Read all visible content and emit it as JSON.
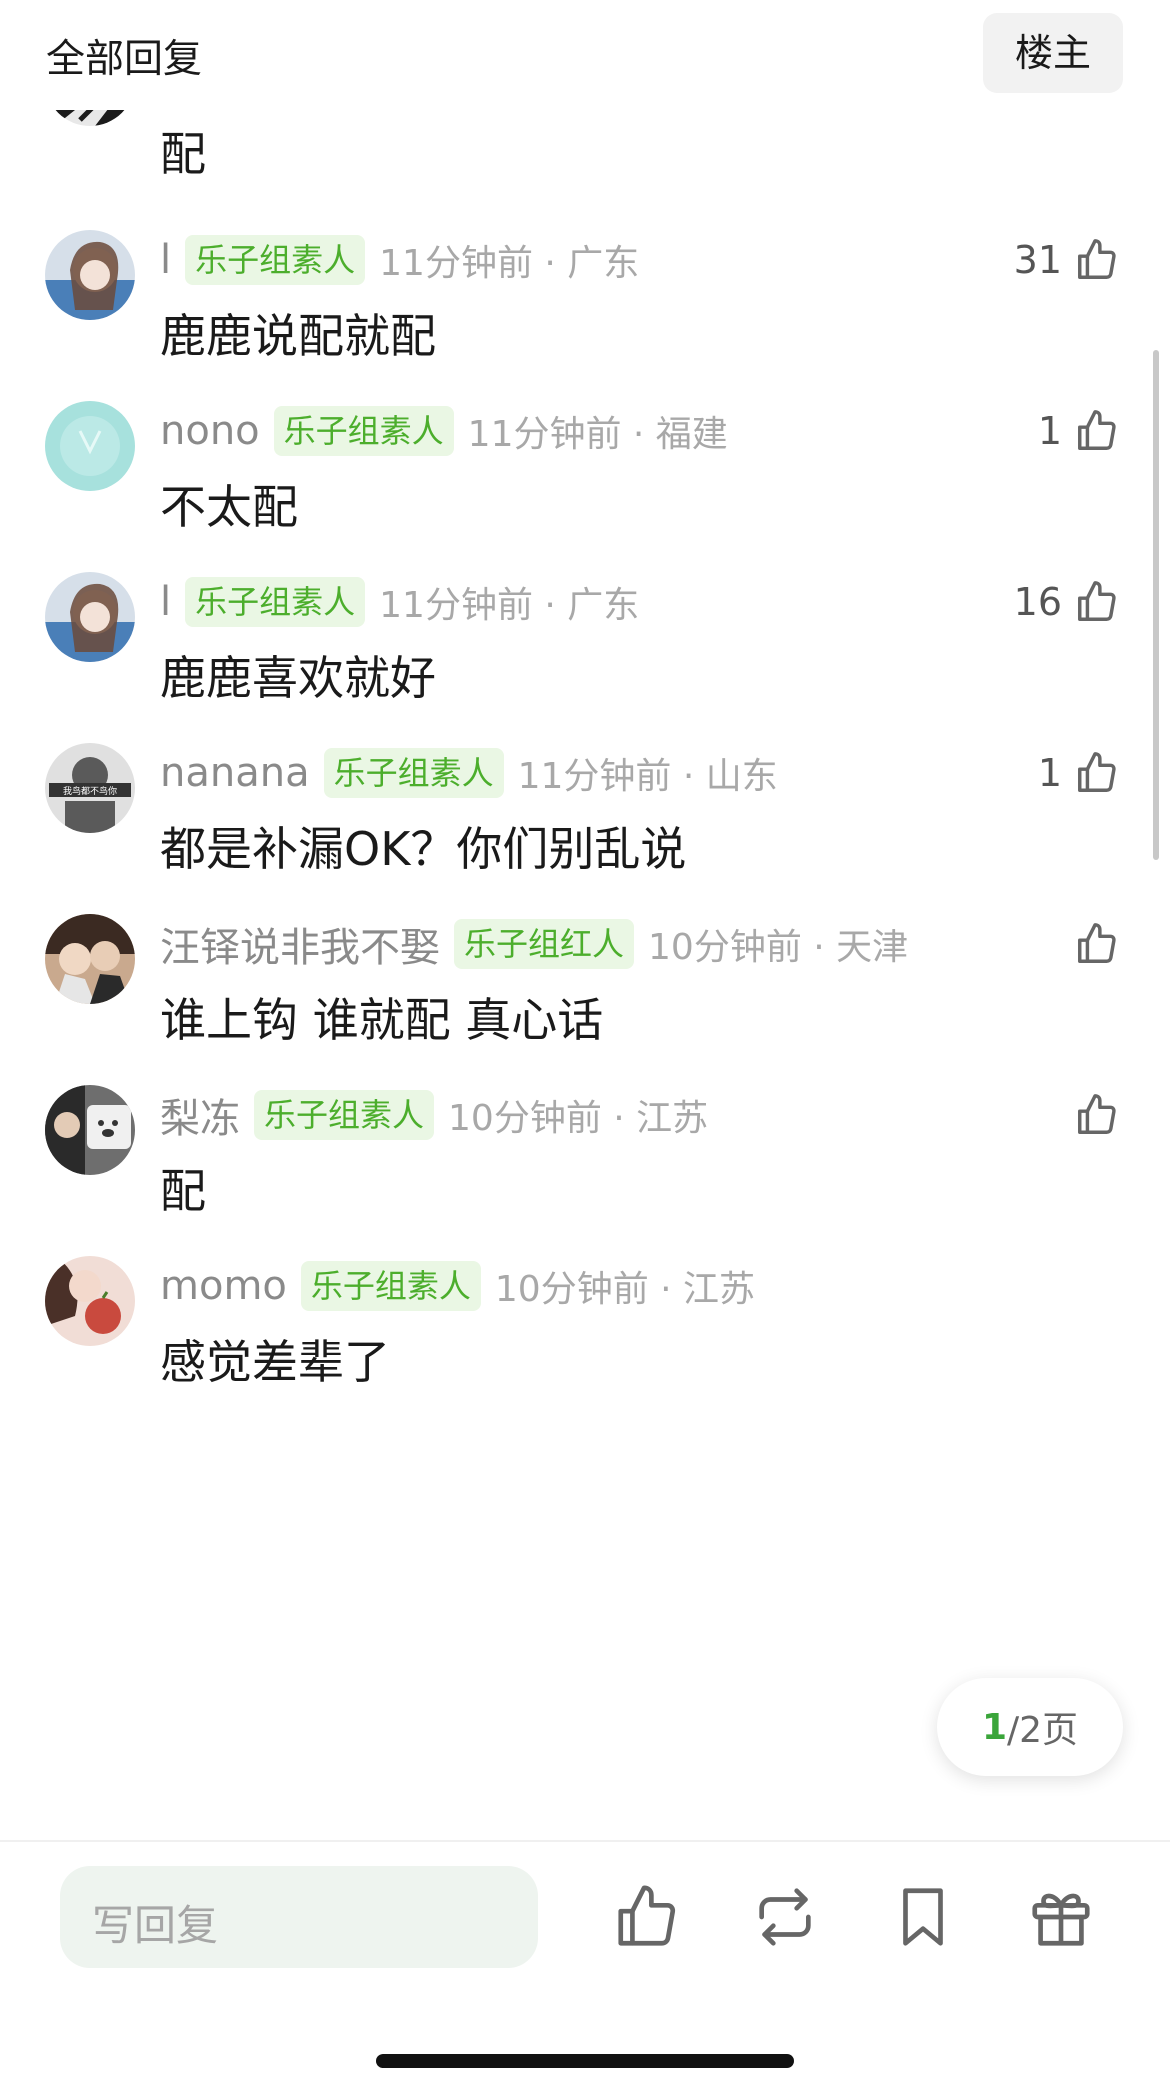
{
  "header": {
    "title": "全部回复",
    "op_button": "楼主"
  },
  "comments": [
    {
      "username": "",
      "badge": "",
      "time": "",
      "likes": "",
      "text": "配",
      "avatar_colors": [
        "#1b1b1b",
        "#e8e8e8"
      ]
    },
    {
      "username": "l",
      "badge": "乐子组素人",
      "time": "11分钟前 · 广东",
      "likes": "31",
      "text": "鹿鹿说配就配",
      "avatar_colors": [
        "#4a7fb8",
        "#d6dfe9"
      ]
    },
    {
      "username": "nono",
      "badge": "乐子组素人",
      "time": "11分钟前 · 福建",
      "likes": "1",
      "text": "不太配",
      "avatar_colors": [
        "#a7e1dd",
        "#c8efec"
      ]
    },
    {
      "username": "l",
      "badge": "乐子组素人",
      "time": "11分钟前 · 广东",
      "likes": "16",
      "text": "鹿鹿喜欢就好",
      "avatar_colors": [
        "#4a7fb8",
        "#d6dfe9"
      ]
    },
    {
      "username": "nanana",
      "badge": "乐子组素人",
      "time": "11分钟前 · 山东",
      "likes": "1",
      "text": "都是补漏OK？你们别乱说",
      "avatar_colors": [
        "#5a5a5a",
        "#e0e0e0"
      ],
      "avatar_text": "我鸟都不鸟你"
    },
    {
      "username": "汪铎说非我不娶",
      "badge": "乐子组红人",
      "time": "10分钟前 · 天津",
      "likes": "",
      "text": "谁上钩 谁就配 真心话",
      "avatar_colors": [
        "#3b2a22",
        "#c9a98e"
      ]
    },
    {
      "username": "梨冻",
      "badge": "乐子组素人",
      "time": "10分钟前 · 江苏",
      "likes": "",
      "text": "配",
      "avatar_colors": [
        "#2a2a2a",
        "#f0f0f0"
      ]
    },
    {
      "username": "momo",
      "badge": "乐子组素人",
      "time": "10分钟前 · 江苏",
      "likes": "",
      "text": "感觉差辈了",
      "avatar_colors": [
        "#c94a3e",
        "#f1ddd6"
      ]
    }
  ],
  "pager": {
    "current": "1",
    "total": "/2页"
  },
  "bottom_bar": {
    "reply_placeholder": "写回复"
  },
  "icons": {
    "like": "thumbs-up-icon",
    "repost": "repost-icon",
    "bookmark": "bookmark-icon",
    "gift": "gift-icon"
  },
  "colors": {
    "badge_bg": "#eaf7e4",
    "badge_text": "#4cae2c",
    "accent": "#3aa53a"
  }
}
